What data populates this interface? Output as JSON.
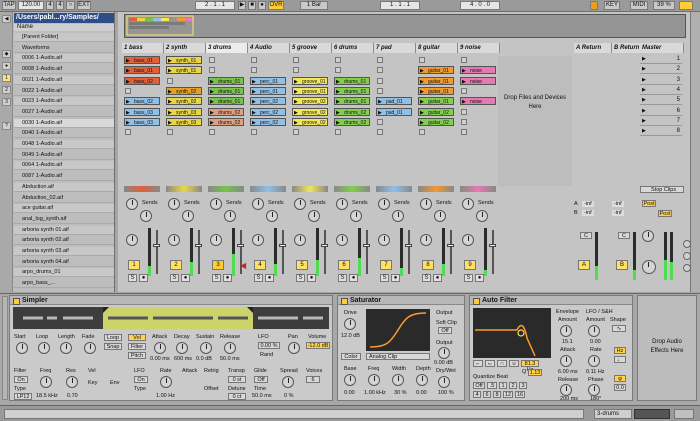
{
  "transport": {
    "tap": "TAP",
    "tempo": "120.00",
    "sig_num": "4",
    "sig_den": "4",
    "metro": "○",
    "ext": "EXT",
    "position": "2 . 1 . 1",
    "ovr": "OVR",
    "quant": "1 Bar",
    "loop_start": "1 . 1 . 1",
    "loop_len": "4 . 0 . 0",
    "key": "KEY",
    "midi": "MIDI",
    "cpu": "39 %"
  },
  "browser": {
    "path": "/Users/pabl...ry/Samples/",
    "column_header": "Name",
    "files": [
      "[Parent Folder]",
      "Waveforms",
      "0006 1-Audio.aif",
      "0008 1-Audio.aif",
      "0021 1-Audio.aif",
      "0022 1-Audio.aif",
      "0023 1-Audio.aif",
      "0027 1-Audio.aif",
      "0030 1-Audio.aif",
      "0040 1-Audio.aif",
      "0048 1-Audio.aif",
      "0049 1-Audio.aif",
      "0064 1-Audio.aif",
      "0087 1-Audio.aif",
      "Abduction.aif",
      "Abduction_02.aif",
      "ace guitar.aif",
      "anal_log_synth.aif",
      "arboria synth 01.aif",
      "arboria synth 02.aif",
      "arboria synth 03.aif",
      "arboria synth 04.aif",
      "arpo_drums_01",
      "arpo_bass_..."
    ]
  },
  "tracks": [
    {
      "name": "1 bass",
      "number": "1",
      "color": "#e0603a"
    },
    {
      "name": "2 synth",
      "number": "2",
      "color": "#e8d64a"
    },
    {
      "name": "3 drums",
      "number": "3",
      "color": "#76c44a"
    },
    {
      "name": "4 Audio",
      "number": "4",
      "color": "#8fc0e8"
    },
    {
      "name": "5 groove",
      "number": "5",
      "color": "#f2e65a"
    },
    {
      "name": "6 drums",
      "number": "6",
      "color": "#82cf4e"
    },
    {
      "name": "7 pad",
      "number": "7",
      "color": "#8fc0e8"
    },
    {
      "name": "8 guitar",
      "number": "8",
      "color": "#ef9a32"
    },
    {
      "name": "9 noise",
      "number": "9",
      "color": "#e47ab0"
    }
  ],
  "returns": [
    {
      "name": "A Return",
      "letter": "A",
      "number": "A"
    },
    {
      "name": "B Return",
      "letter": "B",
      "number": "B"
    }
  ],
  "master": {
    "name": "Master",
    "stop_clips": "Stop Clips",
    "post": "Post"
  },
  "clips": {
    "bass_01": "bass_01",
    "bass_02": "bass_02",
    "bass_03": "bass_03",
    "synth_01": "synth_01",
    "synth_02": "synth_02",
    "synth_03": "synth_03",
    "drums_01": "drums_01",
    "drums_02": "drums_02",
    "perc_01": "perc_01",
    "perc_02": "perc_02",
    "groove_01": "groove_01",
    "groove_02": "groove_02",
    "pad_01": "pad_01",
    "guitar_01": "guitar_01",
    "guitar_02": "guitar_02",
    "noise": "noise"
  },
  "drop_zone": {
    "line1": "Drop Files and Devices",
    "line2": "Here"
  },
  "scenes": [
    "1",
    "2",
    "3",
    "4",
    "5",
    "6",
    "7",
    "8"
  ],
  "mixer": {
    "sends": "Sends",
    "inf": "-inf"
  },
  "simpler": {
    "title": "Simpler",
    "labels": {
      "start": "Start",
      "loop": "Loop",
      "length": "Length",
      "fade": "Fade",
      "loop_btn": "Loop",
      "snap": "Snap",
      "vol": "Vol",
      "filter": "Filter",
      "pitch": "Pitch",
      "attack": "Attack",
      "decay": "Decay",
      "sustain": "Sustain",
      "release": "Release",
      "lfo": "LFO",
      "rand": "Rand",
      "pan": "Pan",
      "volume": "Volume",
      "filter2": "Filter",
      "freq": "Freq",
      "res": "Res",
      "vel": "Vel",
      "key": "Key",
      "env": "Env",
      "type": "Type",
      "lfo2": "LFO",
      "rate": "Rate",
      "lfo_attack": "Attack",
      "retrig": "Retrig",
      "transp": "Transp",
      "detune": "Detune",
      "glide": "Glide",
      "time": "Time",
      "spread": "Spread",
      "voices": "Voices",
      "offset": "Offset"
    },
    "values": {
      "attack": "0.00 ms",
      "decay": "600 ms",
      "sustain": "0.0 dB",
      "release": "50.0 ms",
      "lfo_pct": "0.00 %",
      "volume": "-12.0 dB",
      "freq": "18.5 kHz",
      "res": "0.70",
      "rate": "1.00 Hz",
      "transp": "0 st",
      "detune": "0 ct",
      "time": "50.0 ms",
      "spread": "0 %",
      "voices": "6",
      "type": "LP12"
    }
  },
  "saturator": {
    "title": "Saturator",
    "drive_label": "Drive",
    "drive": "12.0 dB",
    "output_label": "Output",
    "soft_clip": "Soft Clip",
    "off": "Off",
    "color": "Color",
    "mode": "Analog Clip",
    "base": "Base",
    "freq": "Freq",
    "width": "Width",
    "depth": "Depth",
    "base_val": "0.00",
    "freq_val": "1.00 kHz",
    "width_val": "30 %",
    "depth_val": "0.00",
    "output_val": "0.00 dB",
    "drywet": "Dry/Wet",
    "drywet_val": "100 %"
  },
  "autofilter": {
    "title": "Auto Filter",
    "envelope": "Envelope",
    "amount": "Amount",
    "amount_val": "15.1",
    "attack": "Attack",
    "attack_val": "6.00 ms",
    "release": "Release",
    "release_val": "200 ms",
    "lfo": "LFO / S&H",
    "lfo_amount": "Amount",
    "lfo_amount_val": "0.00",
    "shape": "Shape",
    "rate": "Rate",
    "rate_val": "0.11 Hz",
    "hz": "Hz",
    "phase": "Phase",
    "phase_val": "180°",
    "quantize": "Quantize Beat",
    "q": "Q",
    "q_val": "1.13",
    "freq": "81.3 Hz",
    "offset": "0.0"
  },
  "devices_drop": {
    "line1": "Drop Audio",
    "line2": "Effects Here"
  },
  "status": {
    "track": "3-drums"
  }
}
